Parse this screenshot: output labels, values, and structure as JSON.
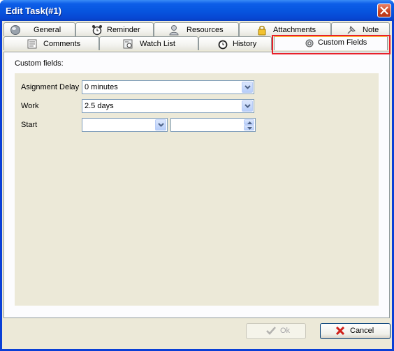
{
  "window": {
    "title": "Edit Task(#1)",
    "close_icon": "close-icon"
  },
  "tabs_row1": [
    {
      "label": "General",
      "icon": "globe-icon"
    },
    {
      "label": "Reminder",
      "icon": "alarm-clock-icon"
    },
    {
      "label": "Resources",
      "icon": "person-icon"
    },
    {
      "label": "Attachments",
      "icon": "lock-icon"
    },
    {
      "label": "Note",
      "icon": "pin-icon"
    }
  ],
  "tabs_row2": [
    {
      "label": "Comments",
      "icon": "comments-icon"
    },
    {
      "label": "Watch List",
      "icon": "watch-list-icon"
    },
    {
      "label": "History",
      "icon": "history-clock-icon"
    },
    {
      "label": "Custom Fields",
      "icon": "gear-icon",
      "active": true
    }
  ],
  "panel": {
    "section_label": "Custom fields:",
    "fields": [
      {
        "label": "Asignment Delay",
        "value": "0 minutes"
      },
      {
        "label": "Work",
        "value": "2.5 days"
      },
      {
        "label": "Start",
        "date_value": "",
        "time_value": ""
      }
    ]
  },
  "buttons": {
    "ok_label": "Ok",
    "cancel_label": "Cancel"
  },
  "colors": {
    "titlebar": "#0756e0",
    "highlight": "#e8202a",
    "active_tab_accent": "#ffc83c"
  }
}
